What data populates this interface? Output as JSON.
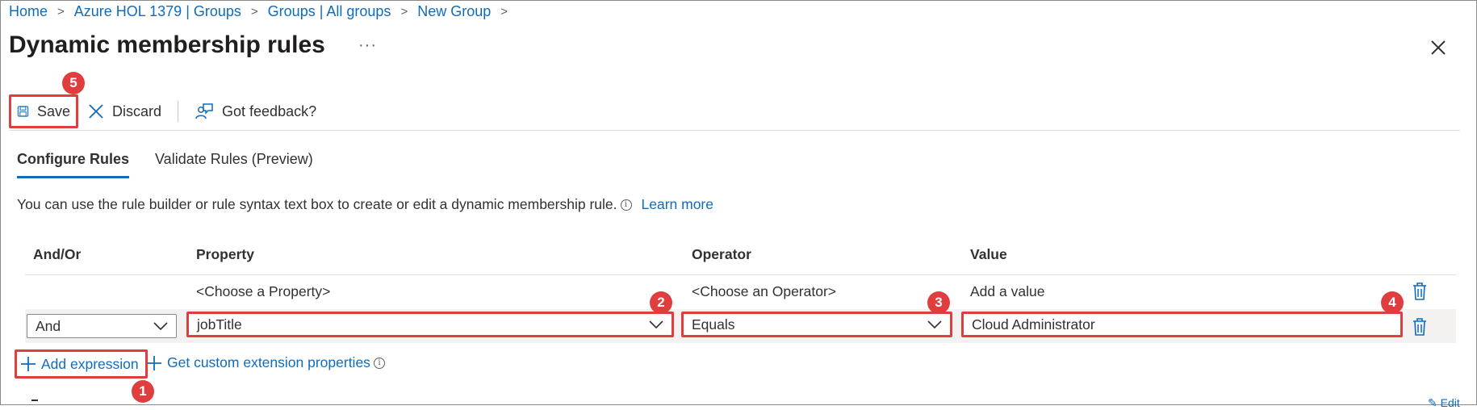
{
  "breadcrumb": [
    "Home",
    "Azure HOL 1379 | Groups",
    "Groups | All groups",
    "New Group"
  ],
  "page_title": "Dynamic membership rules",
  "more_label": "···",
  "toolbar": {
    "save_label": "Save",
    "discard_label": "Discard",
    "feedback_label": "Got feedback?"
  },
  "tabs": [
    {
      "label": "Configure Rules",
      "active": true
    },
    {
      "label": "Validate Rules (Preview)",
      "active": false
    }
  ],
  "description": "You can use the rule builder or rule syntax text box to create or edit a dynamic membership rule.",
  "learn_more": "Learn more",
  "table": {
    "headers": [
      "And/Or",
      "Property",
      "Operator",
      "Value"
    ],
    "row1": {
      "property": "<Choose a Property>",
      "operator": "<Choose an Operator>",
      "value": "Add a value"
    },
    "row2": {
      "and_or": "And",
      "property": "jobTitle",
      "operator": "Equals",
      "value": "Cloud Administrator"
    }
  },
  "add_expression": "Add expression",
  "custom_extension": "Get custom extension properties",
  "edit_fragment": "✎ Edit",
  "callouts": [
    "1",
    "2",
    "3",
    "4",
    "5"
  ],
  "colors": {
    "accent": "#0f6cbd",
    "callout": "#e03e3e"
  }
}
